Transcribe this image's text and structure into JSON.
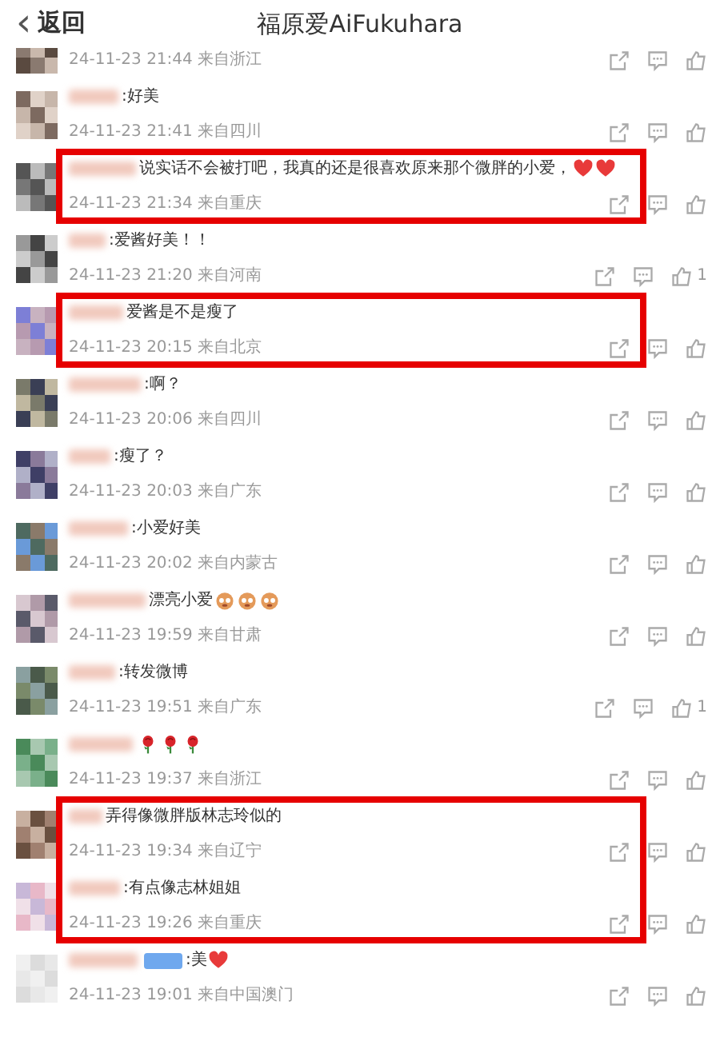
{
  "header": {
    "back_icon": "‹",
    "back_label": "返回",
    "title": "福原爱AiFukuhara"
  },
  "blocks": [
    {
      "highlighted": false,
      "comments": [
        {
          "meta": "24-11-23 21:44 来自浙江"
        },
        {
          "text": ":好美",
          "meta": "24-11-23 21:41 来自四川"
        }
      ]
    },
    {
      "highlighted": true,
      "comments": [
        {
          "text": "说实话不会被打吧，我真的还是很喜欢原来那个微胖的小爱，",
          "stickers": [
            {
              "kind": "heart"
            },
            {
              "kind": "heart"
            }
          ],
          "meta": "24-11-23 21:34 来自重庆"
        }
      ]
    },
    {
      "highlighted": false,
      "comments": [
        {
          "text": ":爱酱好美！！",
          "meta": "24-11-23 21:20 来自河南",
          "likes": "1"
        }
      ]
    },
    {
      "highlighted": true,
      "comments": [
        {
          "text": "爱酱是不是瘦了",
          "meta": "24-11-23 20:15 来自北京"
        }
      ]
    },
    {
      "highlighted": false,
      "comments": [
        {
          "text": ":啊？",
          "meta": "24-11-23 20:06 来自四川"
        },
        {
          "text": ":瘦了？",
          "meta": "24-11-23 20:03 来自广东"
        },
        {
          "text": ":小爱好美",
          "meta": "24-11-23 20:02 来自内蒙古"
        },
        {
          "text": "漂亮小爱",
          "stickers": [
            {
              "kind": "face"
            },
            {
              "kind": "face"
            },
            {
              "kind": "face"
            }
          ],
          "meta": "24-11-23 19:59 来自甘肃"
        },
        {
          "text": ":转发微博",
          "meta": "24-11-23 19:51 来自广东",
          "likes": "1"
        },
        {
          "stickers": [
            {
              "kind": "rose"
            },
            {
              "kind": "rose"
            },
            {
              "kind": "rose"
            }
          ],
          "meta": "24-11-23 19:37 来自浙江"
        }
      ]
    },
    {
      "highlighted": true,
      "comments": [
        {
          "text": "弄得像微胖版林志玲似的",
          "meta": "24-11-23 19:34 来自辽宁"
        },
        {
          "text": ":有点像志林姐姐",
          "meta": "24-11-23 19:26 来自重庆"
        }
      ]
    },
    {
      "highlighted": false,
      "comments": [
        {
          "badge": true,
          "text": ":美",
          "stickers": [
            {
              "kind": "heart"
            }
          ],
          "meta": "24-11-23 19:01 来自中国澳门"
        }
      ]
    }
  ]
}
